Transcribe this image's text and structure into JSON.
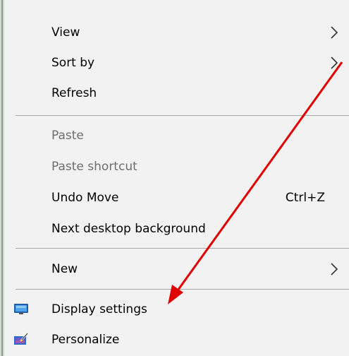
{
  "menu": {
    "items": [
      {
        "label": "View",
        "submenu_icon": "chevron-right-icon"
      },
      {
        "label": "Sort by",
        "submenu_icon": "chevron-right-icon"
      },
      {
        "label": "Refresh"
      },
      {
        "label": "Paste",
        "disabled": true
      },
      {
        "label": "Paste shortcut",
        "disabled": true
      },
      {
        "label": "Undo Move",
        "shortcut": "Ctrl+Z"
      },
      {
        "label": "Next desktop background"
      },
      {
        "label": "New",
        "submenu_icon": "chevron-right-icon"
      },
      {
        "label": "Display settings",
        "icon": "display-icon"
      },
      {
        "label": "Personalize",
        "icon": "personalize-icon"
      }
    ]
  },
  "annotation": {
    "arrow_color": "#e00000",
    "icon": "red-arrow-pointing-to-display-settings"
  },
  "colors": {
    "menu_background": "#f2f2f2",
    "separator": "#a9a9a9",
    "disabled_text": "#6d6d6d"
  }
}
